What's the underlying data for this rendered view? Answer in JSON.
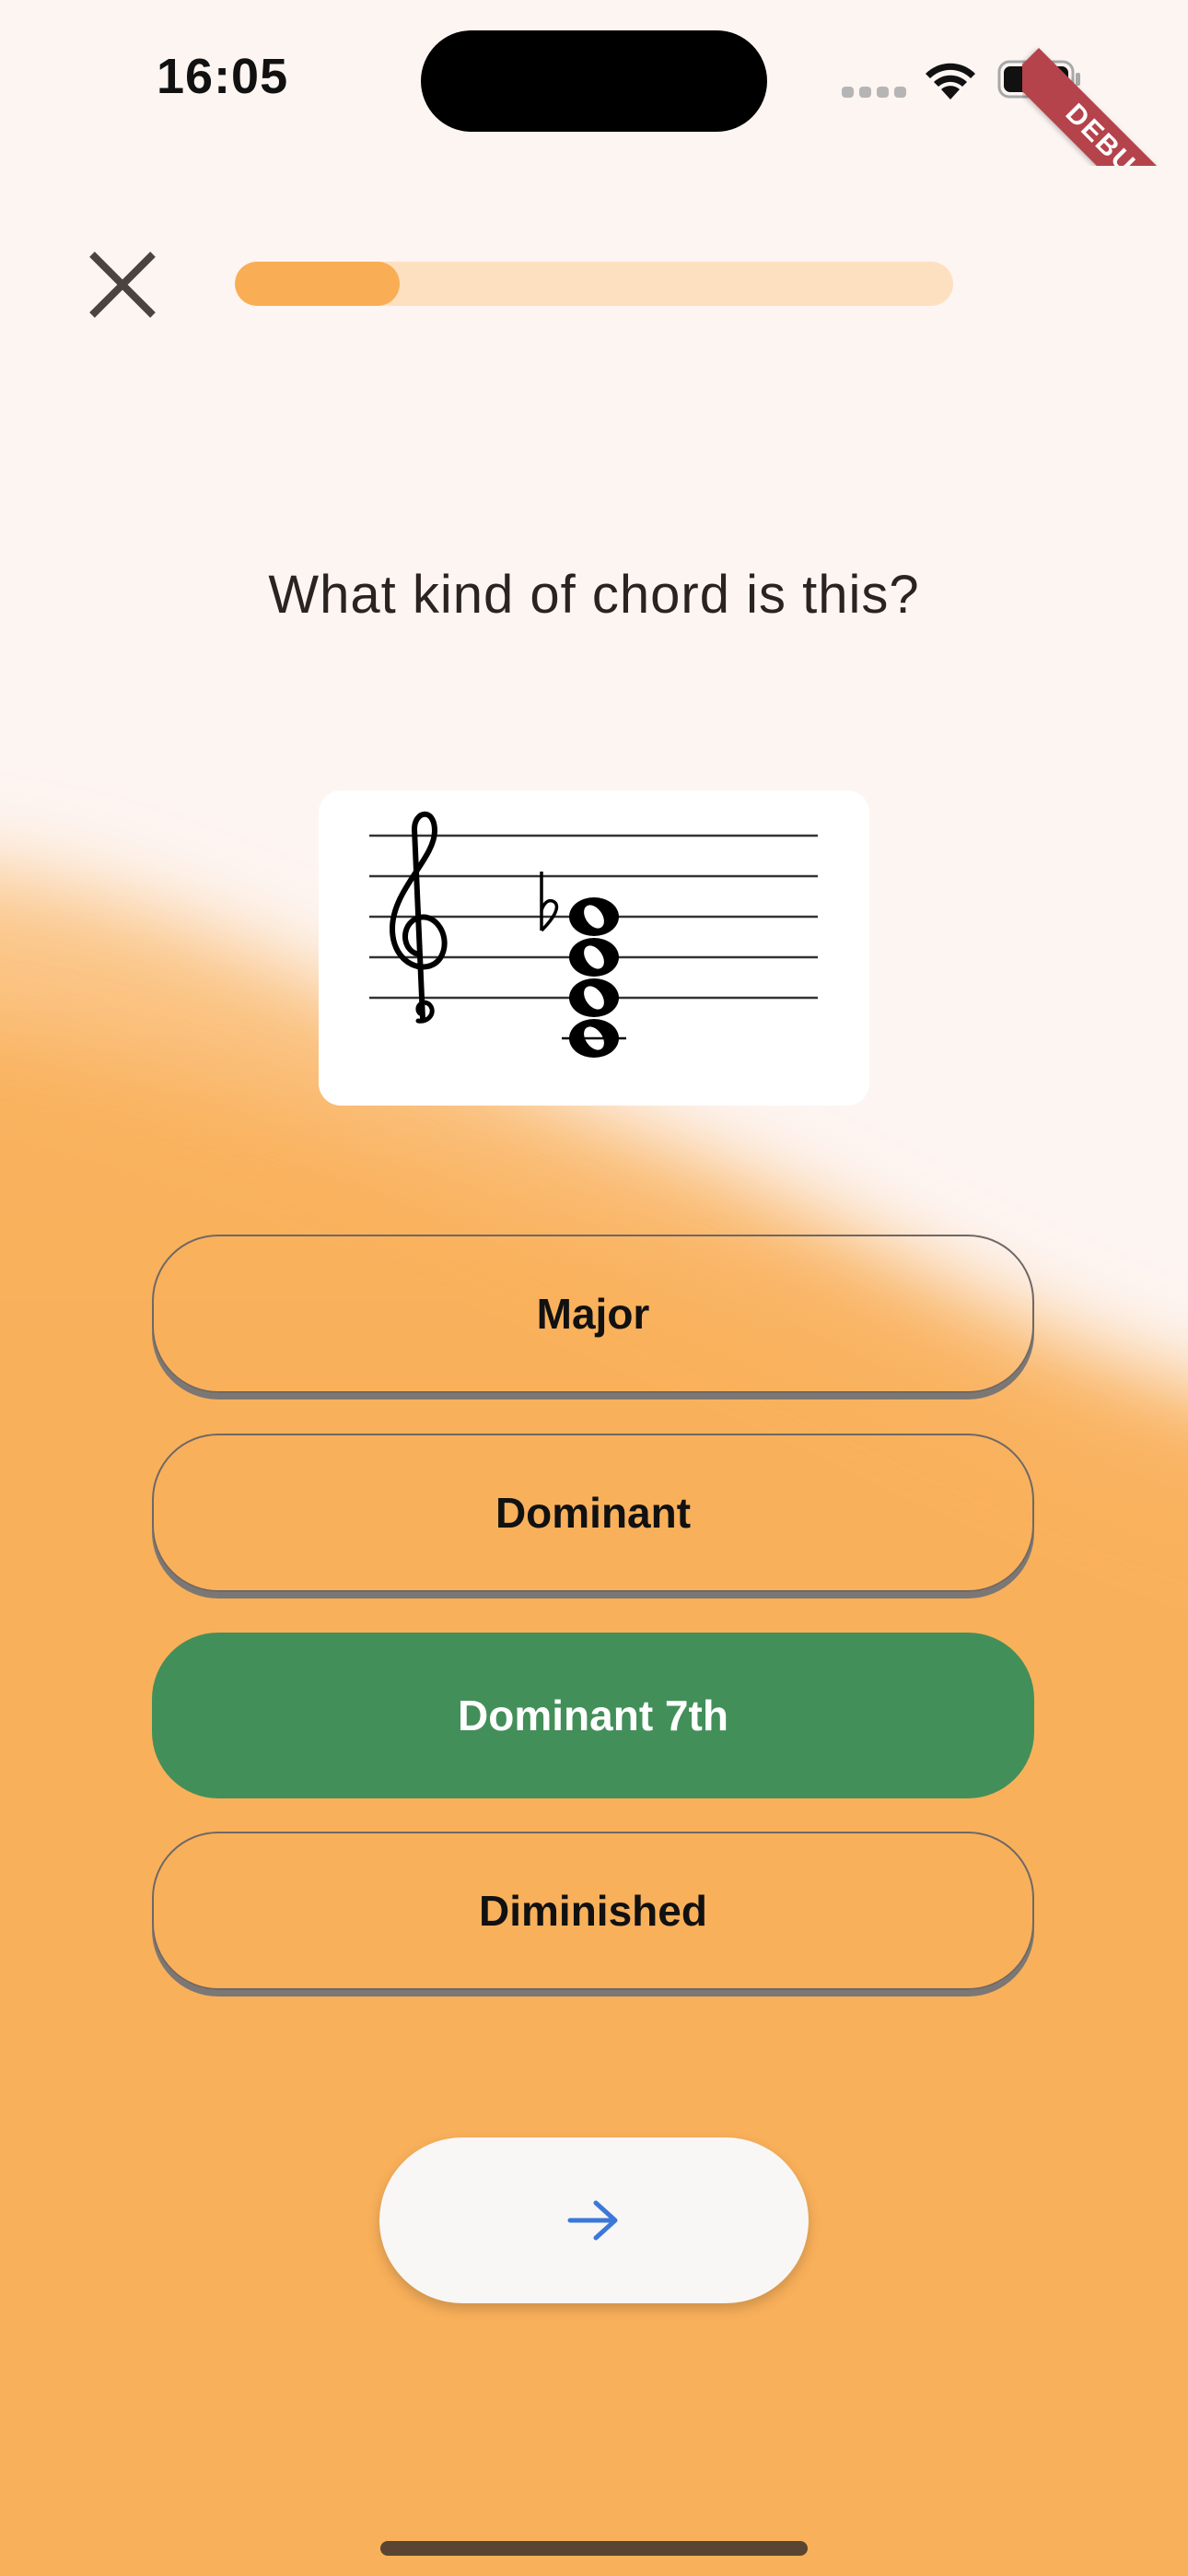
{
  "status_bar": {
    "time": "16:05",
    "icons": [
      "signal-icon",
      "wifi-icon",
      "battery-icon"
    ]
  },
  "debug_banner": "DEBUG",
  "header": {
    "close_icon": "close-icon",
    "progress_fraction": 0.23
  },
  "quiz": {
    "question": "What kind of chord is this?",
    "staff": {
      "clef": "treble",
      "accidental": "flat",
      "notes": 4
    },
    "options": [
      {
        "label": "Major",
        "state": "default"
      },
      {
        "label": "Dominant",
        "state": "default"
      },
      {
        "label": "Dominant 7th",
        "state": "correct"
      },
      {
        "label": "Diminished",
        "state": "default"
      }
    ],
    "next_icon": "arrow-right-icon"
  },
  "colors": {
    "background_top": "#fdf5f2",
    "background_bottom": "#f9b05a",
    "progress_track": "#fde0c0",
    "progress_fill": "#f9ae55",
    "correct_green": "#438f59",
    "arrow_blue": "#3b78d8",
    "debug_red": "#b5434b"
  }
}
